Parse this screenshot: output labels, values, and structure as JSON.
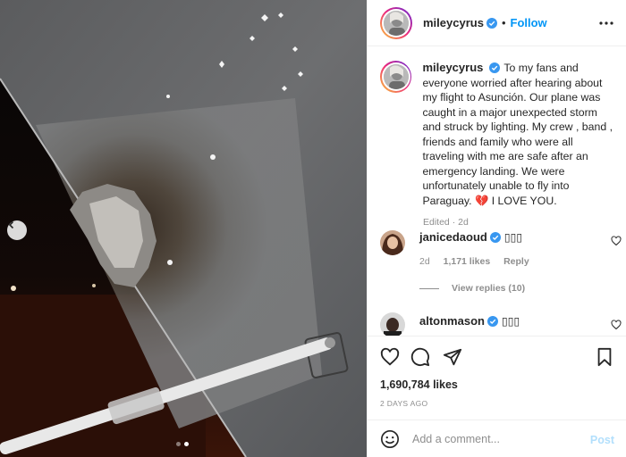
{
  "post": {
    "username": "mileycyrus",
    "follow_label": "Follow",
    "dot": "•",
    "caption": "To my fans and everyone worried after hearing about my flight to Asunción. Our plane was caught in a major unexpected storm and struck by lighting. My crew , band , friends and family who were all traveling with me are safe after an emergency landing. We were unfortunately unable to fly into Paraguay. 💔 I LOVE YOU.",
    "caption_meta": "Edited · 2d",
    "likes": "1,690,784 likes",
    "age": "2 DAYS AGO",
    "carousel_index": 2,
    "carousel_total": 2
  },
  "comments": [
    {
      "username": "janicedaoud",
      "text": "▯▯▯",
      "age": "2d",
      "likes": "1,171 likes",
      "reply_label": "Reply",
      "view_replies": "View replies (10)"
    },
    {
      "username": "altonmason",
      "text": "▯▯▯"
    }
  ],
  "composer": {
    "placeholder": "Add a comment...",
    "post_label": "Post"
  },
  "icons": {
    "more": "more-horizontal-icon",
    "like": "heart-icon",
    "comment": "comment-icon",
    "share": "paper-plane-icon",
    "save": "bookmark-icon",
    "emoji": "emoji-icon",
    "verified": "verified-badge-icon",
    "prev": "chevron-left-icon"
  },
  "colors": {
    "accent": "#0095f6",
    "verified": "#3897f0",
    "muted": "#8e8e8e",
    "post_disabled": "#b2dffc"
  }
}
